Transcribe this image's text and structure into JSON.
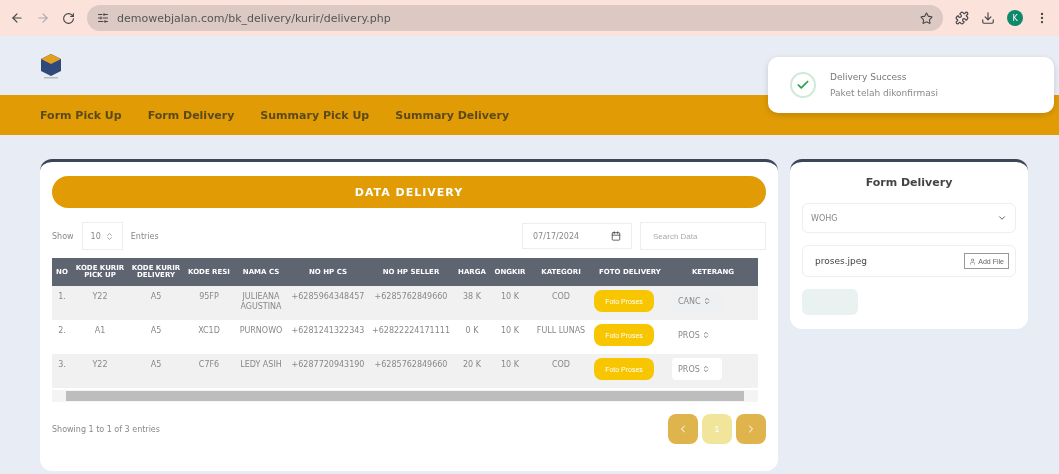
{
  "browser": {
    "url": "demowebjalan.com/bk_delivery/kurir/delivery.php",
    "avatar": "K"
  },
  "nav": [
    "Form Pick Up",
    "Form Delivery",
    "Summary Pick Up",
    "Summary Delivery"
  ],
  "toast": {
    "title": "Delivery Success",
    "message": "Paket telah dikonfirmasi"
  },
  "table_card": {
    "title": "DATA DELIVERY",
    "show_label": "Show",
    "entries_value": "10",
    "entries_label": "Entries",
    "date": "07/17/2024",
    "search_placeholder": "Search Data",
    "columns": [
      "NO",
      "KODE KURIR PICK UP",
      "KODE KURIR DELIVERY",
      "KODE RESI",
      "NAMA CS",
      "NO HP CS",
      "NO HP SELLER",
      "HARGA",
      "ONGKIR",
      "KATEGORI",
      "FOTO DELIVERY",
      "KETERANG"
    ],
    "rows": [
      {
        "cells": [
          "1.",
          "Y22",
          "A5",
          "95FP",
          "JULIEANA AGUSTINA",
          "+6285964348457",
          "+6285762849660",
          "38 K",
          "10 K",
          "COD"
        ],
        "photo_button": "Foto Proses",
        "status": "CANC"
      },
      {
        "cells": [
          "2.",
          "A1",
          "A5",
          "XC1D",
          "PURNOWO",
          "+6281241322343",
          "+62822224171111",
          "0 K",
          "10 K",
          "FULL LUNAS"
        ],
        "photo_button": "Foto Proses",
        "status": "PROS"
      },
      {
        "cells": [
          "3.",
          "Y22",
          "A5",
          "C7F6",
          "LEDY ASIH",
          "+6287720943190",
          "+6285762849660",
          "20 K",
          "10 K",
          "COD"
        ],
        "photo_button": "Foto Proses",
        "status": "PROS"
      }
    ],
    "footer": "Showing 1 to 1 of 3 entries",
    "page": "1"
  },
  "form_card": {
    "title": "Form Delivery",
    "select_value": "WOHG",
    "file_name": "proses.jpeg",
    "file_button": "Add File"
  }
}
